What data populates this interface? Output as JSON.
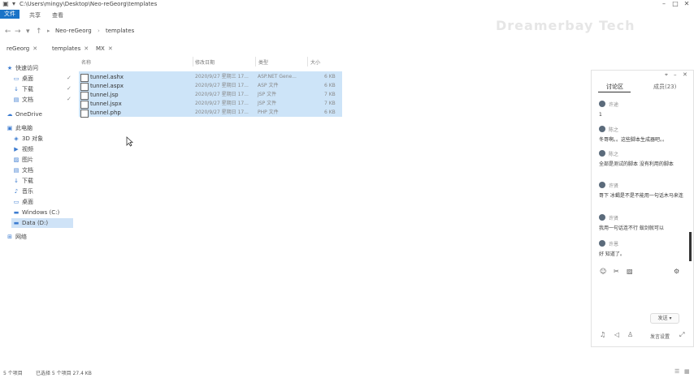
{
  "window": {
    "title_path": "C:\\Users\\mingy\\Desktop\\Neo-reGeorg\\templates"
  },
  "menu": {
    "file": "文件",
    "share": "共享",
    "view": "查看"
  },
  "address": {
    "crumbs": [
      "Neo-reGeorg",
      "templates"
    ]
  },
  "tabs": [
    {
      "label": "reGeorg"
    },
    {
      "label": "templates"
    },
    {
      "label": "MX"
    }
  ],
  "nav": {
    "quick_access": "快速访问",
    "desktop": "桌面",
    "downloads": "下载",
    "documents": "文档",
    "onedrive": "OneDrive",
    "this_pc": "此电脑",
    "objects3d": "3D 对象",
    "videos": "视频",
    "pictures": "图片",
    "pc_documents": "文档",
    "pc_downloads": "下载",
    "music": "音乐",
    "pc_desktop": "桌面",
    "windows_c": "Windows (C:)",
    "data_d": "Data (D:)",
    "network": "网络"
  },
  "columns": {
    "name": "名称",
    "date": "修改日期",
    "type": "类型",
    "size": "大小"
  },
  "files": [
    {
      "name": "tunnel.ashx",
      "date": "2020/9/27 星期三 17...",
      "type": "ASP.NET Gene...",
      "size": "6 KB",
      "icon": "ashx-file-icon"
    },
    {
      "name": "tunnel.aspx",
      "date": "2020/9/27 星期日 17...",
      "type": "ASP 文件",
      "size": "6 KB",
      "icon": "aspx-file-icon"
    },
    {
      "name": "tunnel.jsp",
      "date": "2020/9/27 星期日 17...",
      "type": "JSP 文件",
      "size": "7 KB",
      "icon": "jsp-file-icon"
    },
    {
      "name": "tunnel.jspx",
      "date": "2020/9/27 星期日 17...",
      "type": "JSP 文件",
      "size": "7 KB",
      "icon": "jspx-file-icon"
    },
    {
      "name": "tunnel.php",
      "date": "2020/9/27 星期日 17...",
      "type": "PHP 文件",
      "size": "6 KB",
      "icon": "php-file-icon"
    }
  ],
  "status": {
    "items": "5 个项目",
    "selected": "已选择 5 个项目 27.4 KB"
  },
  "watermark": "Dreamerbay Tech",
  "chat": {
    "tab_discussion": "讨论区",
    "tab_members": "成员(23)",
    "messages": [
      {
        "user": "许途",
        "text": "1"
      },
      {
        "user": "陈之",
        "text": "冬哥啊。。这些脚本生成器吧。。"
      },
      {
        "user": "陈之",
        "text": "全部是测试的脚本 没有利用的脚本"
      },
      {
        "user": "许贤",
        "text": "哥下 冰蝎是不是不能用一句话木马来连"
      },
      {
        "user": "许贤",
        "text": "我用一句话连不行 蚁剑就可以"
      },
      {
        "user": "许恩",
        "text": "好 知道了。"
      }
    ],
    "send_label": "发送",
    "bottom_right": "发言设置"
  },
  "colors": {
    "accent": "#1a73c7",
    "selection": "#cde4f8"
  }
}
